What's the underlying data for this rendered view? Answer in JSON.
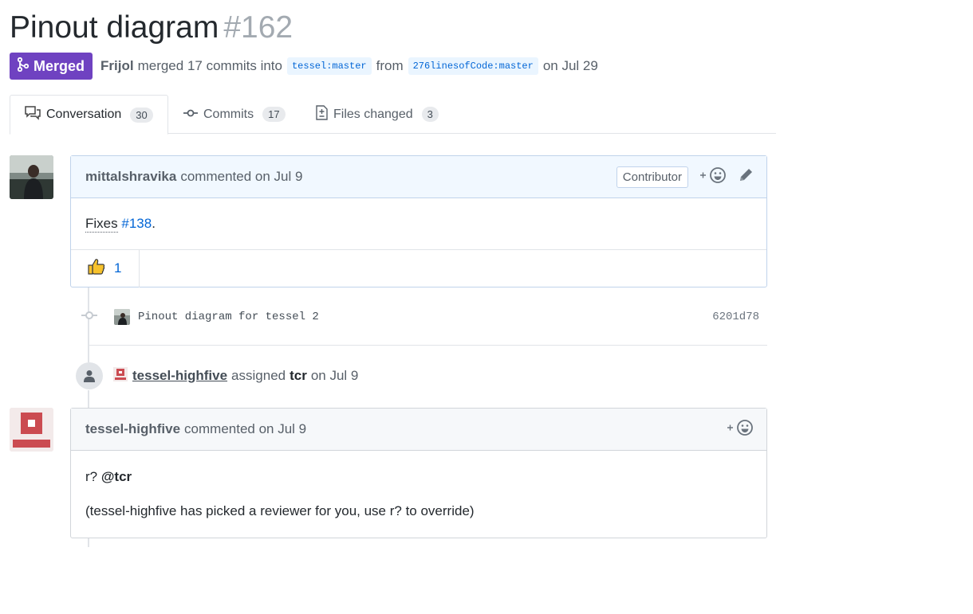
{
  "pr": {
    "title": "Pinout diagram",
    "number": "#162",
    "state": "Merged",
    "author": "Frijol",
    "merged_text": "merged 17 commits into",
    "base_branch": "tessel:master",
    "from_text": "from",
    "head_branch": "276linesofCode:master",
    "date_text": "on Jul 29"
  },
  "tabs": [
    {
      "label": "Conversation",
      "count": "30"
    },
    {
      "label": "Commits",
      "count": "17"
    },
    {
      "label": "Files changed",
      "count": "3"
    }
  ],
  "comment1": {
    "author": "mittalshravika",
    "action": "commented on Jul 9",
    "badge": "Contributor",
    "body_word": "Fixes",
    "body_link": "#138",
    "body_tail": ".",
    "reaction_count": "1"
  },
  "commit": {
    "message": "Pinout diagram for tessel 2",
    "sha": "6201d78"
  },
  "event": {
    "actor": "tessel-highfive",
    "action": "assigned",
    "assignee": "tcr",
    "date": "on Jul 9"
  },
  "comment2": {
    "author": "tessel-highfive",
    "action": "commented on Jul 9",
    "line1_prefix": "r?",
    "line1_mention": "@tcr",
    "line2": "(tessel-highfive has picked a reviewer for you, use r? to override)"
  },
  "colors": {
    "merged": "#6f42c1",
    "link": "#0366d6",
    "highfive": "#cb4b51"
  }
}
